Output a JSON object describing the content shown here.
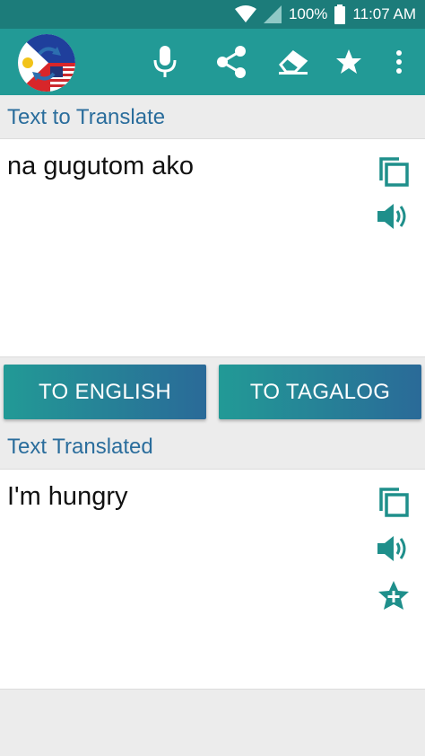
{
  "status_bar": {
    "battery": "100%",
    "time": "11:07 AM",
    "icons": [
      "wifi-icon",
      "cell-signal-icon",
      "battery-icon"
    ]
  },
  "app_bar": {
    "logo": "flag-translate-logo",
    "actions": [
      "microphone-icon",
      "share-icon",
      "eraser-icon",
      "star-icon",
      "overflow-menu-icon"
    ]
  },
  "input_section": {
    "label": "Text to Translate",
    "text": "na gugutom ako",
    "actions": [
      "copy-icon",
      "speaker-icon"
    ]
  },
  "buttons": {
    "to_english": "TO ENGLISH",
    "to_tagalog": "TO TAGALOG"
  },
  "output_section": {
    "label": "Text Translated",
    "text": "I'm hungry",
    "actions": [
      "copy-icon",
      "speaker-icon",
      "add-favorite-icon"
    ]
  },
  "colors": {
    "status_bar": "#1c7c7a",
    "app_bar": "#229a96",
    "label_blue": "#2a6d9c",
    "icon_teal": "#1f8f8b",
    "button_gradient_start": "#229a96",
    "button_gradient_end": "#2a6a98"
  }
}
